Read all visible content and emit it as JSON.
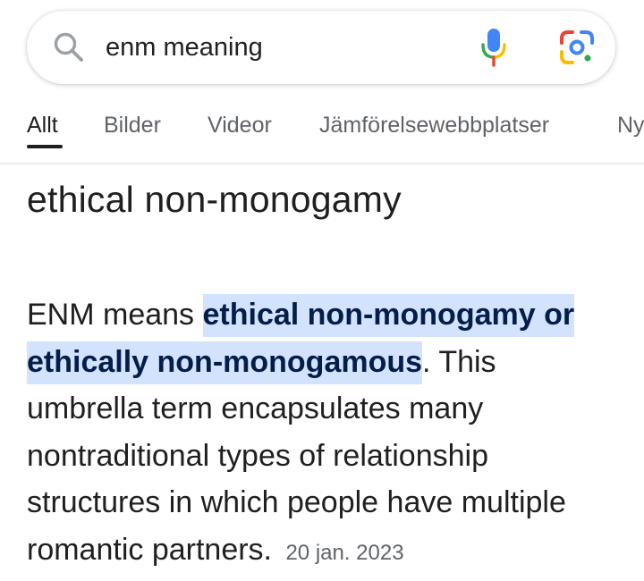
{
  "search": {
    "query": "enm meaning"
  },
  "icons": {
    "search": "search-icon",
    "mic": "microphone-icon",
    "lens": "google-lens-icon"
  },
  "colors": {
    "highlight_bg": "#d3e3fd",
    "highlight_text": "#041e49",
    "muted_text": "#5f6368",
    "mic_blue": "#4285f4",
    "mic_red": "#ea4335",
    "mic_yellow": "#fbbc04",
    "mic_green": "#34a853"
  },
  "tabs": [
    {
      "label": "Allt",
      "active": true
    },
    {
      "label": "Bilder",
      "active": false
    },
    {
      "label": "Videor",
      "active": false
    },
    {
      "label": "Jämförelsewebbplatser",
      "active": false
    },
    {
      "label": "Nyheter",
      "active": false
    }
  ],
  "snippet": {
    "title": "ethical non-monogamy",
    "intro": "ENM means ",
    "highlight": "ethical non-monogamy or ethically non-monogamous",
    "rest": ". This umbrella term encapsulates many nontraditional types of relationship structures in which people have multiple romantic partners.",
    "date": "20 jan. 2023"
  }
}
